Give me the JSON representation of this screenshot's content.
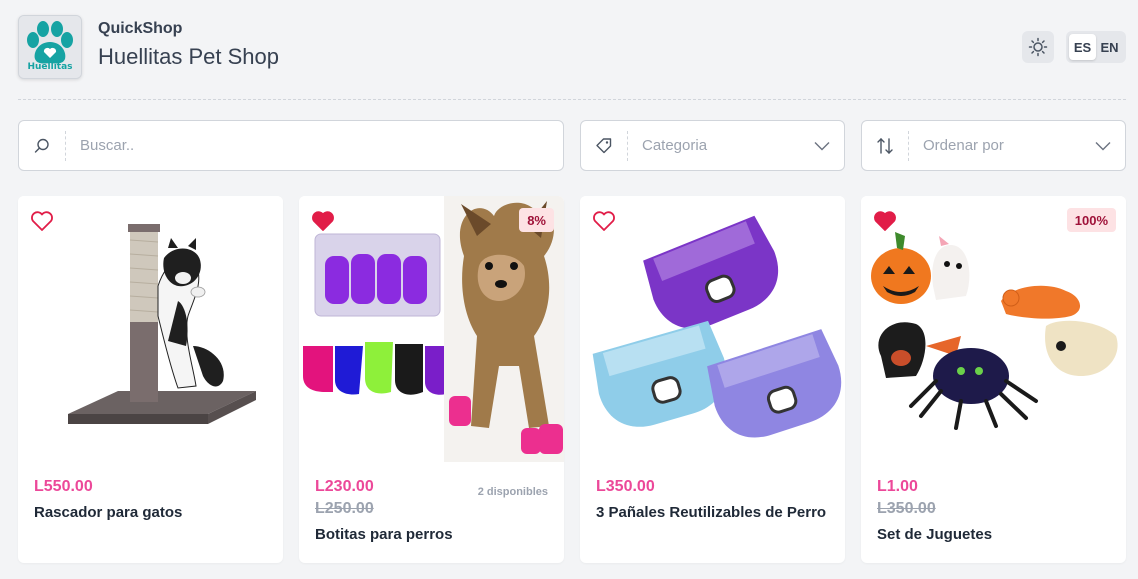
{
  "header": {
    "app_name": "QuickShop",
    "store_name": "Huellitas Pet Shop",
    "logo_text": "Huellitas",
    "theme_icon": "sun-icon",
    "languages": [
      {
        "code": "ES",
        "active": true
      },
      {
        "code": "EN",
        "active": false
      }
    ]
  },
  "filters": {
    "search_placeholder": "Buscar..",
    "category_placeholder": "Categoria",
    "sort_placeholder": "Ordenar por"
  },
  "colors": {
    "accent": "#ec4899",
    "favorite": "#e11d48",
    "badge_bg": "#fde2e4",
    "logo_teal": "#16a3a3"
  },
  "products": [
    {
      "name": "Rascador para gatos",
      "price": "L550.00",
      "old_price": "",
      "badge": "",
      "availability": "",
      "favorite": false
    },
    {
      "name": "Botitas para perros",
      "price": "L230.00",
      "old_price": "L250.00",
      "badge": "8%",
      "availability": "2 disponibles",
      "favorite": true
    },
    {
      "name": "3 Pañales Reutilizables de Perro",
      "price": "L350.00",
      "old_price": "",
      "badge": "",
      "availability": "",
      "favorite": false
    },
    {
      "name": "Set de Juguetes",
      "price": "L1.00",
      "old_price": "L350.00",
      "badge": "100%",
      "availability": "",
      "favorite": true
    }
  ]
}
